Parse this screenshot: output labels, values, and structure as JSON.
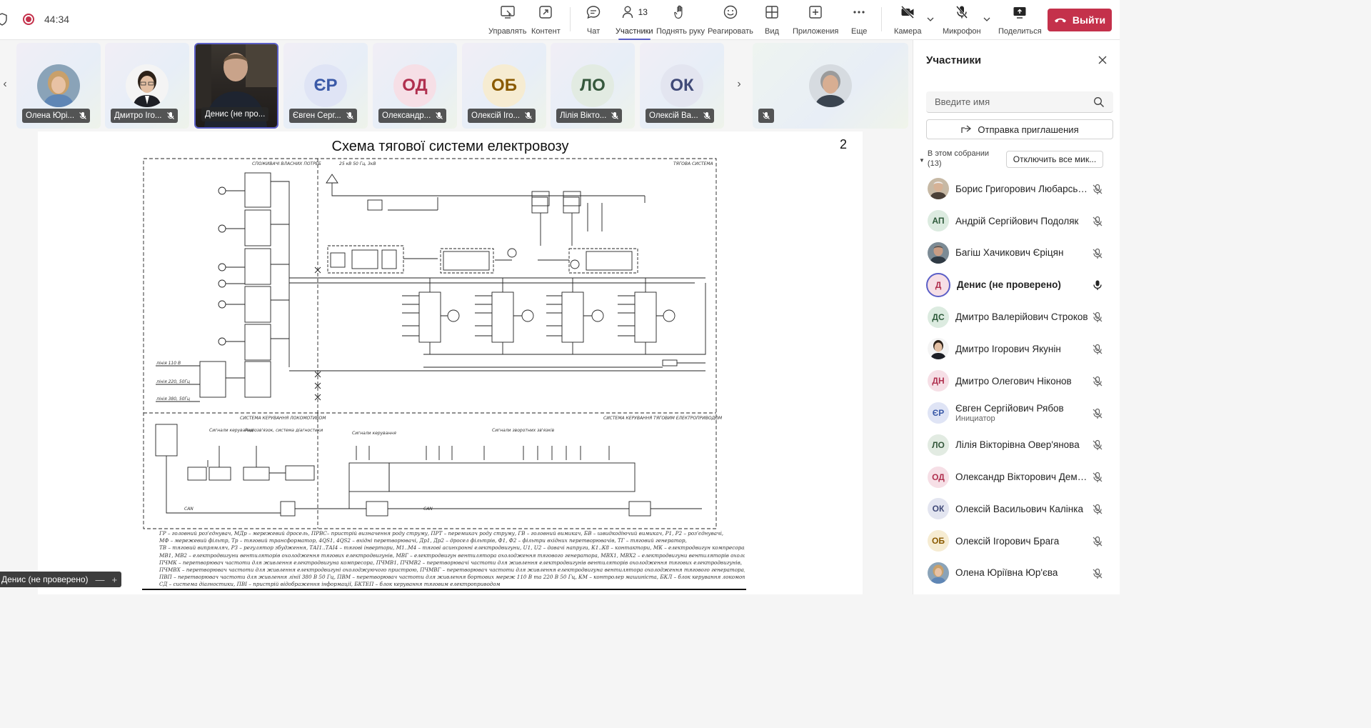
{
  "meeting": {
    "timer": "44:34",
    "colors": {
      "accent": "#5b5fc7",
      "leave": "#c4314b"
    }
  },
  "toolbar": {
    "manage": "Управлять",
    "content": "Контент",
    "chat": "Чат",
    "participants": "Участники",
    "participants_count": "13",
    "raise_hand": "Поднять руку",
    "react": "Реагировать",
    "view": "Вид",
    "apps": "Приложения",
    "more": "Еще",
    "camera": "Камера",
    "mic": "Микрофон",
    "share": "Поделиться",
    "leave": "Выйти"
  },
  "strip": {
    "tiles": [
      {
        "name": "Олена Юрі...",
        "initials": "",
        "type": "photo-woman"
      },
      {
        "name": "Дмитро Іго...",
        "initials": "",
        "type": "photo-man-glasses"
      },
      {
        "name": "Денис (не про...",
        "initials": "",
        "type": "video"
      },
      {
        "name": "Євген Серг...",
        "initials": "ЄР",
        "bg": "#dfe4f5",
        "fg": "#3b5aa8"
      },
      {
        "name": "Олександр...",
        "initials": "ОД",
        "bg": "#f6dfe6",
        "fg": "#b0304f"
      },
      {
        "name": "Олексій Іго...",
        "initials": "ОБ",
        "bg": "#f6ecd2",
        "fg": "#8a5a00"
      },
      {
        "name": "Лілія Вікто...",
        "initials": "ЛО",
        "bg": "#e2ebe2",
        "fg": "#35583c"
      },
      {
        "name": "Олексій Ва...",
        "initials": "ОК",
        "bg": "#e3e5f0",
        "fg": "#404a78"
      }
    ]
  },
  "slide": {
    "title": "Схема тягової системи електровозу",
    "page_number": "2",
    "labels": {
      "own_needs": "СПОЖИВАЧІ ВЛАСНИХ ПОТРЕБ",
      "traction": "ТЯГОВА СИСТЕМА",
      "supply": "25 кВ 50 Гц, 3кВ",
      "loco_control": "СИСТЕМА КЕРУВАННЯ ЛОКОМОТИВОМ",
      "drive_control": "СИСТЕМА КЕРУВАННЯ ТЯГОВИМ ЕЛЕКТРОПРИВОДОМ",
      "line110": "лінія 110 В",
      "line220": "лінія 220, 50Гц",
      "line380": "лінія 380, 50Гц",
      "control_signals": "Сигнали керування",
      "diag_signals": "Радіозв'язок, система діагностики",
      "feedback_signals": "Сигнали зворотних зв'язків",
      "can": "CAN"
    },
    "legend": [
      "ГР – головний роз'єднувач, МДр – мережевий дросель, ПРВС– пристрій визначення роду струму, ПРТ – перемикач роду струму, ГВ – головний вимикач, БВ – швидкодіючий вимикач, Р1, Р2 – роз'єднувачі,",
      "МФ – мережевий фільтр, Тр – тяговий трансформатор, 4QS1, 4QS2 – вхідні перетворювачі, Др1, Др2 – дросел фільтрів, Ф1, Ф2 – фільтри вхідних перетворювачів, ТГ – тяговий генератор,",
      "ТВ – тяговий випрямляч, РЗ – регулятор збудження, ТАІ1..ТАІ4 – тягові інвертори, М1..М4 – тягові асинхронні електродвигуни, U1, U2 – давачі напруги, К1..К8 – контактори, МК – електродвигун компресора,",
      "МВ1, МВ2 – електродвигуни вентиляторів охолодження тягових електродвигунів, МВГ – електродвигун вентилятора охолодження тягового генератора, МВХ1, МВХ2 – електродвигуни вентиляторів охолоджуючого пристрою,",
      "ПЧМК – перетворювач частоти для живлення електродвигуна компресора, ПЧМВ1, ПЧМВ2 – перетворювачі частоти для живлення електродвигунів вентиляторів охолодження тягових електродвигунів,",
      "ПЧМВХ – перетворювач частоти для живлення електродвигуні охолоджуючого пристрою, ПЧМВГ – перетворювач частоти для живлення електродвигуна вентилятора охолодження тягового генератора,",
      "ПВП – перетворювач частоти для живлення лінії 380 В 50 Гц, ПВМ – перетворювач частоти для живлення бортових мереж 110 В та 220 В 50 Гц, КМ – контролер машиніста, БКЛ – блок керування локомотивом,",
      "СД – система діагностики, ПВІ – пристрій відображення інформації, БКТЕП – блок керування тяговим електроприводом"
    ]
  },
  "self_view": {
    "label": "Денис (не проверено)",
    "minus": "—",
    "plus": "+"
  },
  "panel": {
    "title": "Участники",
    "search_placeholder": "Введите имя",
    "invite": "Отправка приглашения",
    "section": "В этом собрании (13)",
    "mute_all": "Отключить все мик...",
    "people": [
      {
        "name": "Борис Григорович Любарськ...",
        "initials": "",
        "avatar": "photo-older",
        "mic": "muted"
      },
      {
        "name": "Андрій Сергійович Подоляк",
        "initials": "АП",
        "bg": "#dcebe0",
        "fg": "#2d5a3a",
        "mic": "muted"
      },
      {
        "name": "Багіш Хачикович Єріцян",
        "initials": "",
        "avatar": "photo-grey",
        "mic": "muted"
      },
      {
        "name": "Денис (не проверено)",
        "initials": "Д",
        "bg": "#f6dfe6",
        "fg": "#b0304f",
        "mic": "on",
        "bold": true,
        "ring": true
      },
      {
        "name": "Дмитро Валерійович Строков",
        "initials": "ДС",
        "bg": "#dcebe0",
        "fg": "#2d5a3a",
        "mic": "muted"
      },
      {
        "name": "Дмитро Ігорович Якунін",
        "initials": "",
        "avatar": "photo-man-glasses",
        "mic": "muted"
      },
      {
        "name": "Дмитро Олегович Ніконов",
        "initials": "ДН",
        "bg": "#f6dfe6",
        "fg": "#b0304f",
        "mic": "muted"
      },
      {
        "name": "Євген Сергійович Рябов",
        "role": "Инициатор",
        "initials": "ЄР",
        "bg": "#dfe4f5",
        "fg": "#3b5aa8",
        "mic": "muted"
      },
      {
        "name": "Лілія Вікторівна Овер'янова",
        "initials": "ЛО",
        "bg": "#e2ebe2",
        "fg": "#35583c",
        "mic": "muted"
      },
      {
        "name": "Олександр Вікторович Деми...",
        "initials": "ОД",
        "bg": "#f6dfe6",
        "fg": "#b0304f",
        "mic": "muted"
      },
      {
        "name": "Олексій Васильович Калінка",
        "initials": "ОК",
        "bg": "#e3e5f0",
        "fg": "#404a78",
        "mic": "muted"
      },
      {
        "name": "Олексій Ігорович Брага",
        "initials": "ОБ",
        "bg": "#f6ecd2",
        "fg": "#8a5a00",
        "mic": "muted"
      },
      {
        "name": "Олена Юріївна Юр'єва",
        "initials": "",
        "avatar": "photo-woman",
        "mic": "muted"
      }
    ]
  }
}
